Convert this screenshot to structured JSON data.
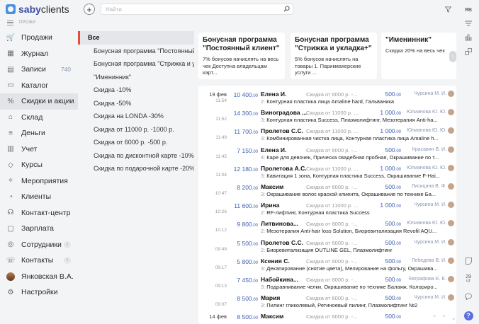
{
  "app": {
    "logo_primary": "saby",
    "logo_secondary": "clients",
    "profile_label": "ПРОФИ"
  },
  "search": {
    "placeholder": "Найти"
  },
  "right_toolbar": {
    "initials": "ЯВ",
    "day": "29",
    "weekday": "ЧТ",
    "help": "?"
  },
  "nav": [
    {
      "label": "Продажи",
      "icon": "cart-icon"
    },
    {
      "label": "Журнал",
      "icon": "calendar-icon"
    },
    {
      "label": "Записи",
      "icon": "notebook-icon",
      "count": "740"
    },
    {
      "label": "Каталог",
      "icon": "catalog-icon"
    },
    {
      "label": "Скидки и акции",
      "icon": "percent-icon",
      "active": true
    },
    {
      "label": "Склад",
      "icon": "warehouse-icon"
    },
    {
      "label": "Деньги",
      "icon": "money-icon"
    },
    {
      "label": "Учет",
      "icon": "ledger-icon"
    },
    {
      "label": "Курсы",
      "icon": "course-icon"
    },
    {
      "label": "Мероприятия",
      "icon": "event-icon"
    },
    {
      "label": "Клиенты",
      "icon": "clients-icon"
    },
    {
      "label": "Контакт-центр",
      "icon": "headset-icon"
    },
    {
      "label": "Зарплата",
      "icon": "salary-icon"
    },
    {
      "label": "Сотрудники",
      "icon": "staff-icon",
      "chevron": true
    },
    {
      "label": "Контакты",
      "icon": "contacts-icon",
      "chevron": true
    },
    {
      "label": "Янковская В.А.",
      "icon": "user-avatar"
    },
    {
      "label": "Настройки",
      "icon": "gear-icon"
    }
  ],
  "filters": [
    "Все",
    "Бонусная программа \"Постоянный клиент\"",
    "Бонусная программа \"Стрижка и укладка+\"",
    "\"Именинник\"",
    "Скидка -10%",
    "Скидка -50%",
    "Скидка на LONDA -30%",
    "Скидка от 11000 р. -1000 р.",
    "Скидка от 6000 р. -500 р.",
    "Скидка по дисконтной карте -10%",
    "Скидка по подарочной карте -20%"
  ],
  "cards": [
    {
      "title": "Бонусная программа \"Постоянный клиент\"",
      "desc": "7% бонусов начислять на весь чек Доступна владельцам карт..."
    },
    {
      "title": "Бонусная программа \"Стрижка и укладка+\"",
      "desc": "5% бонусов начислять на товары 1. Парикмахерские услуги ..."
    },
    {
      "title": "\"Именинник\"",
      "desc": "Скидка 20% на весь чек"
    }
  ],
  "rows": [
    {
      "date": "19 фев",
      "time": "11:54",
      "amount": "10 400",
      "cents": ".00",
      "client": "Елена И.",
      "discount": "Скидка от 6000 р. -...",
      "disc_amount": "500",
      "disc_cents": ".00",
      "employee": "Чурсина М. И.",
      "qty": "2:",
      "services": "Контурная пластика лица Amaline hard, Гальваника"
    },
    {
      "date": "",
      "time": "11:52",
      "amount": "14 300",
      "cents": ".00",
      "client": "Виноградова ...",
      "discount": "Скидка от 11000 р. ...",
      "disc_amount": "1 000",
      "disc_cents": ".00",
      "employee": "Юлианова Ю. Ю.",
      "qty": "3:",
      "services": "Контурная пластика Success, Плазмолифтинг, Мезотерапия Anti-ha..."
    },
    {
      "date": "",
      "time": "11:49",
      "amount": "11 700",
      "cents": ".00",
      "client": "Пролетов С.С.",
      "discount": "Скидка от 11000 р. ...",
      "disc_amount": "1 000",
      "disc_cents": ".00",
      "employee": "Юлианова Ю. Ю.",
      "qty": "3:",
      "services": "Комбинированная чистка лица, Контурная пластика лица Amaline h..."
    },
    {
      "date": "",
      "time": "11:45",
      "amount": "7 150",
      "cents": ".00",
      "client": "Елена И.",
      "discount": "Скидка от 6000 р. -...",
      "disc_amount": "500",
      "disc_cents": ".00",
      "employee": "Красавин В. И.",
      "qty": "4:",
      "services": "Каре для девочек, Прическа свадебная пробная, Окрашивание по т..."
    },
    {
      "date": "",
      "time": "11:04",
      "amount": "12 180",
      "cents": ".00",
      "client": "Пролетова А.С.",
      "discount": "Скидка от 11000 р. ...",
      "disc_amount": "1 000",
      "disc_cents": ".00",
      "employee": "Юлианова Ю. Ю.",
      "qty": "3:",
      "services": "Кавитация 1 зона, Контурная пластика Success, Окрашивание F-Hai..."
    },
    {
      "date": "",
      "time": "10:47",
      "amount": "8 200",
      "cents": ".00",
      "client": "Максим",
      "discount": "Скидка от 6000 р. -...",
      "disc_amount": "500",
      "disc_cents": ".00",
      "employee": "Лисицина В. Ф.",
      "qty": "3:",
      "services": "Окрашивание волос краской клиента, Окрашивание по технике Ба..."
    },
    {
      "date": "",
      "time": "10:26",
      "amount": "11 600",
      "cents": ".00",
      "client": "Ирина",
      "discount": "Скидка от 11000 р. ...",
      "disc_amount": "1 000",
      "disc_cents": ".00",
      "employee": "Чурсина М. И.",
      "qty": "2:",
      "services": "RF-лифтинг, Контурная пластика Success"
    },
    {
      "date": "",
      "time": "10:12",
      "amount": "9 800",
      "cents": ".00",
      "client": "Литвинова...",
      "discount": "Скидка от 6000 р. -...",
      "disc_amount": "500",
      "disc_cents": ".00",
      "employee": "Юлианова Ю. Ю.",
      "qty": "2:",
      "services": "Мезотерапия Anti-hair loss Solution, Биоревитализация Revofil AQU..."
    },
    {
      "date": "",
      "time": "09:49",
      "amount": "5 500",
      "cents": ".00",
      "client": "Пролетов С.С.",
      "discount": "Скидка от 6000 р. -...",
      "disc_amount": "500",
      "disc_cents": ".00",
      "employee": "Чурсина М. И.",
      "qty": "2:",
      "services": "Биоревитализация OUTLINE GEL, Плазмолифтинг"
    },
    {
      "date": "",
      "time": "09:17",
      "amount": "5 800",
      "cents": ".00",
      "client": "Ксения С.",
      "discount": "Скидка от 6000 р. -...",
      "disc_amount": "500",
      "disc_cents": ".00",
      "employee": "Лебедева В. И.",
      "qty": "3:",
      "services": "Декапирование (снятие цвета), Мелирование на фольгу, Окрашива..."
    },
    {
      "date": "",
      "time": "09:13",
      "amount": "7 450",
      "cents": ".00",
      "client": "Набойкина...",
      "discount": "Скидка от 6000 р. -...",
      "disc_amount": "500",
      "disc_cents": ".00",
      "employee": "Евграфова Е. Е.",
      "qty": "3:",
      "services": "Подравнивание челки, Окрашивание по технике Балаяж, Колориро..."
    },
    {
      "date": "",
      "time": "09:07",
      "amount": "8 500",
      "cents": ".00",
      "client": "Мария",
      "discount": "Скидка от 6000 р. -...",
      "disc_amount": "500",
      "disc_cents": ".00",
      "employee": "Чурсина М. И.",
      "qty": "3:",
      "services": "Пилинг гликолевый, Ретиноевый пилинг, Плазмолифтинг №2"
    },
    {
      "date": "14 фев",
      "time": "",
      "amount": "8 500",
      "cents": ".00",
      "client": "Максим",
      "discount": "Скидка от 6000 р. -...",
      "disc_amount": "500",
      "disc_cents": ".00",
      "employee": "",
      "qty": "",
      "services": ""
    }
  ]
}
